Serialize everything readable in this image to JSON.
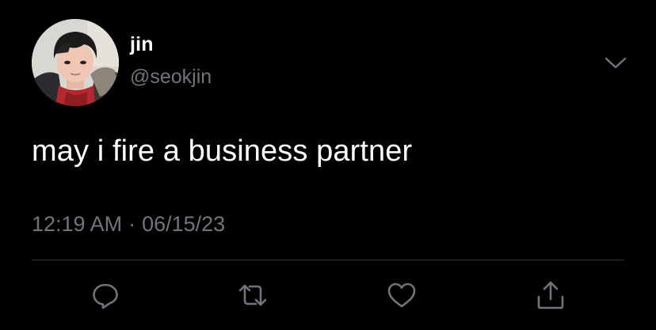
{
  "tweet": {
    "author": {
      "display_name": "jin",
      "handle": "@seokjin"
    },
    "text": "may i fire a business partner",
    "time": "12:19 AM",
    "separator": "·",
    "date": "06/15/23"
  },
  "actions": {
    "reply_icon": "reply-icon",
    "retweet_icon": "retweet-icon",
    "like_icon": "heart-icon",
    "share_icon": "share-icon"
  },
  "colors": {
    "background": "#000000",
    "text_primary": "#ffffff",
    "text_secondary": "#6e767d",
    "divider": "#2f3336",
    "icon": "#6e767d"
  }
}
